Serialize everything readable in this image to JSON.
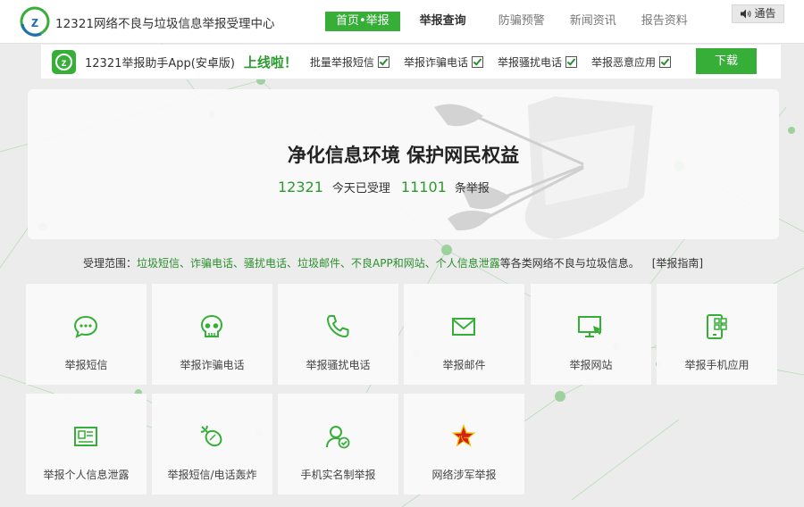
{
  "header": {
    "site_title": "12321网络不良与垃圾信息举报受理中心",
    "nav": [
      {
        "label": "首页•举报"
      },
      {
        "label": "举报查询"
      },
      {
        "label": "防骗预警"
      },
      {
        "label": "新闻资讯"
      },
      {
        "label": "报告资料"
      }
    ],
    "notice_label": "通告"
  },
  "app_bar": {
    "app_name": "12321举报助手App(安卓版)",
    "online_text": "上线啦！",
    "features": [
      {
        "label": "批量举报短信"
      },
      {
        "label": "举报诈骗电话"
      },
      {
        "label": "举报骚扰电话"
      },
      {
        "label": "举报恶意应用"
      }
    ],
    "download_label": "下载"
  },
  "hero": {
    "title": "净化信息环境 保护网民权益",
    "count_today": "12321",
    "today_text": "今天已受理",
    "count_reports": "11101",
    "reports_text": "条举报"
  },
  "scope": {
    "prefix": "受理范围：",
    "items": "垃圾短信、诈骗电话、骚扰电话、垃圾邮件、不良APP和网站、个人信息泄露",
    "suffix": "等各类网络不良与垃圾信息。",
    "guide": "[举报指南]"
  },
  "tiles": [
    {
      "label": "举报短信",
      "icon": "chat-bubble-icon"
    },
    {
      "label": "举报诈骗电话",
      "icon": "skull-icon"
    },
    {
      "label": "举报骚扰电话",
      "icon": "phone-icon"
    },
    {
      "label": "举报邮件",
      "icon": "envelope-icon"
    },
    {
      "label": "举报网站",
      "icon": "monitor-cursor-icon"
    },
    {
      "label": "举报手机应用",
      "icon": "phone-apps-icon"
    },
    {
      "label": "举报个人信息泄露",
      "icon": "id-card-icon"
    },
    {
      "label": "举报短信/电话轰炸",
      "icon": "bomb-icon"
    },
    {
      "label": "手机实名制举报",
      "icon": "user-check-icon"
    },
    {
      "label": "网络涉军举报",
      "icon": "army-star-icon"
    }
  ],
  "colors": {
    "brand_green": "#36ae38",
    "dark_green": "#2c9a2e",
    "army_red": "#d4201a",
    "army_gold": "#f2c200"
  }
}
